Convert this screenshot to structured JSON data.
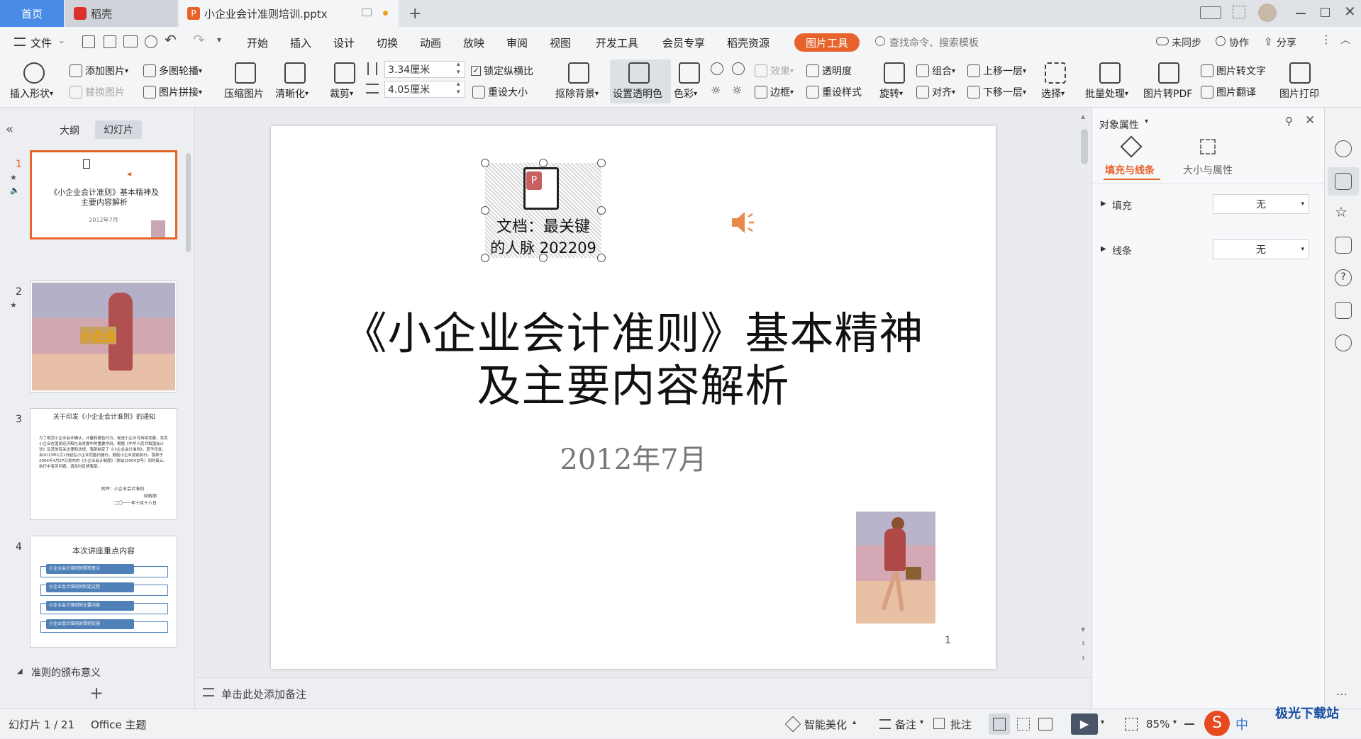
{
  "tabs": {
    "home": "首页",
    "daoke": "稻壳",
    "doc": "小企业会计准则培训.pptx",
    "new_tab": "+"
  },
  "menu": {
    "file": "文件",
    "items": [
      "开始",
      "插入",
      "设计",
      "切换",
      "动画",
      "放映",
      "审阅",
      "视图",
      "开发工具",
      "会员专享",
      "稻壳资源"
    ],
    "picture_tools": "图片工具",
    "search_placeholder": "查找命令、搜索模板",
    "sync": "未同步",
    "collab": "协作",
    "share": "分享"
  },
  "ribbon": {
    "insert_shape": "插入形状",
    "add_picture": "添加图片",
    "replace_picture": "替换图片",
    "multi_contour": "多图轮播",
    "picture_mosaic": "图片拼接",
    "compress": "压缩图片",
    "sharpen": "清晰化",
    "crop": "裁剪",
    "height": "3.34厘米",
    "width": "4.05厘米",
    "lock_ratio": "锁定纵横比",
    "reset_size": "重设大小",
    "remove_bg": "抠除背景",
    "set_transparent": "设置透明色",
    "color": "色彩",
    "effects": "效果",
    "transparency": "透明度",
    "border": "边框",
    "reset_style": "重设样式",
    "rotate": "旋转",
    "group": "组合",
    "align": "对齐",
    "bring_forward": "上移一层",
    "send_backward": "下移一层",
    "select": "选择",
    "batch": "批量处理",
    "to_pdf": "图片转PDF",
    "to_text": "图片转文字",
    "translate": "图片翻译",
    "print": "图片打印"
  },
  "left_panel": {
    "outline_tab": "大纲",
    "slides_tab": "幻灯片",
    "section_label": "准则的颁布意义",
    "slides": [
      {
        "num": "1",
        "title": "《小企业会计准则》基本精神及主要内容解析",
        "date": "2012年7月",
        "icon_text": "文档：最关键的人脉 202209"
      },
      {
        "num": "2",
        "label": "小企业"
      },
      {
        "num": "3",
        "title": "关于印发《小企业会计准则》的通知",
        "body": "为了规范小企业会计确认、计量和报告行为，促进小企业可持续发展，发挥小企业在国民经济和社会发展中的重要作用，根据《中华人民共和国会计法》及其他有关法律和法规，我部制定了《小企业会计准则》，现予印发，自2013年1月1日起在小企业范围内施行，鼓励小企业提前执行。我部于2004年4月27日发布的《小企业会计制度》（财会[2004]2号）同时废止。执行中有何问题，请及时反馈我部。",
        "attach": "附件：小企业会计准则",
        "dept": "财政部",
        "signdate": "二〇一一年十月十八日"
      },
      {
        "num": "4",
        "title": "本次讲座重点内容",
        "items": [
          "小企业会计准则的颁布意义",
          "小企业会计准则的制定过程",
          "小企业会计准则的主要内容",
          "小企业会计准则的贯彻实施"
        ]
      }
    ]
  },
  "slide": {
    "title_line1": "《小企业会计准则》基本精神",
    "title_line2": "及主要内容解析",
    "date": "2012年7月",
    "icon_caption_1": "文档：最关键",
    "icon_caption_2": "的人脉 202209",
    "page_number": "1"
  },
  "notes_placeholder": "单击此处添加备注",
  "right_panel": {
    "title": "对象属性",
    "tab_fill": "填充与线条",
    "tab_size": "大小与属性",
    "fill_label": "填充",
    "fill_value": "无",
    "line_label": "线条",
    "line_value": "无"
  },
  "status": {
    "slide_info": "幻灯片 1 / 21",
    "theme": "Office 主题",
    "smart_beautify": "智能美化",
    "notes": "备注",
    "comment": "批注",
    "zoom": "85%",
    "watermark": "极光下载站"
  },
  "colors": {
    "accent": "#e8632c",
    "tab_active_blue": "#4a8be6",
    "wps_red": "#d9302b"
  }
}
